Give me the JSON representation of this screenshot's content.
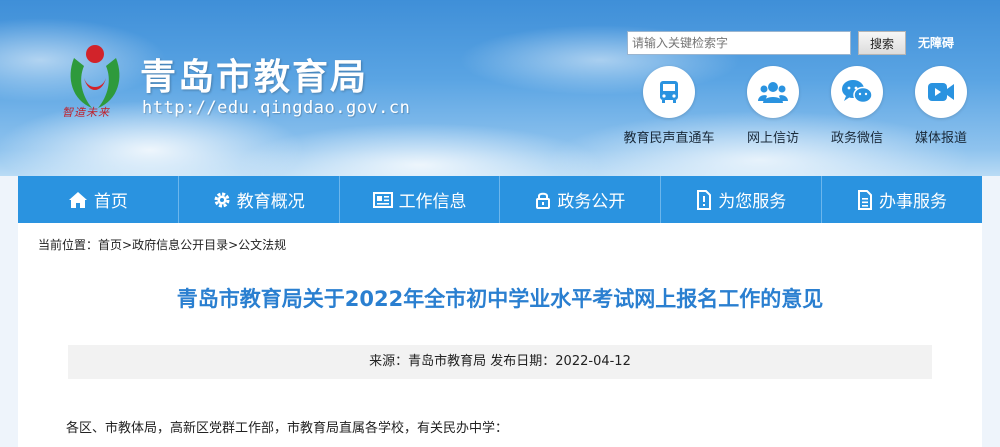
{
  "header": {
    "site_title": "青岛市教育局",
    "site_url": "http://edu.qingdao.gov.cn",
    "logo_script": "智造未来",
    "search_placeholder": "请输入关键检索字",
    "search_button": "搜索",
    "accessibility_link": "无障碍"
  },
  "quick_links": [
    {
      "label": "教育民声直通车",
      "icon": "bus-icon"
    },
    {
      "label": "网上信访",
      "icon": "users-icon"
    },
    {
      "label": "政务微信",
      "icon": "wechat-icon"
    },
    {
      "label": "媒体报道",
      "icon": "video-icon"
    }
  ],
  "nav": {
    "items": [
      {
        "label": "首页",
        "icon": "home-icon"
      },
      {
        "label": "教育概况",
        "icon": "gear-icon"
      },
      {
        "label": "工作信息",
        "icon": "news-icon"
      },
      {
        "label": "政务公开",
        "icon": "lock-icon"
      },
      {
        "label": "为您服务",
        "icon": "document-icon"
      },
      {
        "label": "办事服务",
        "icon": "file-icon"
      }
    ]
  },
  "breadcrumb": {
    "prefix": "当前位置：",
    "items": [
      "首页",
      "政府信息公开目录",
      "公文法规"
    ],
    "separator": ">"
  },
  "article": {
    "title": "青岛市教育局关于2022年全市初中学业水平考试网上报名工作的意见",
    "meta": "来源：青岛市教育局 发布日期：2022-04-12",
    "first_line": "各区、市教体局，高新区党群工作部，市教育局直属各学校，有关民办中学："
  },
  "colors": {
    "nav_bg": "#2a93e0",
    "title_blue": "#2a7fd0",
    "logo_green": "#2e9a3c",
    "logo_red": "#d2232a"
  }
}
